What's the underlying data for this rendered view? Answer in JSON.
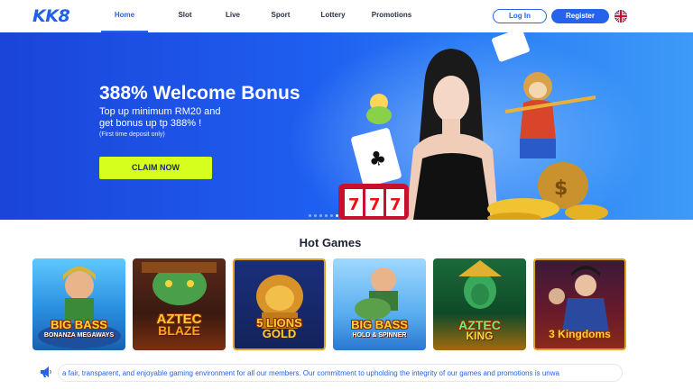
{
  "header": {
    "logo": "KK8",
    "nav": [
      {
        "label": "Home",
        "active": true
      },
      {
        "label": "Slot",
        "active": false
      },
      {
        "label": "Live",
        "active": false
      },
      {
        "label": "Sport",
        "active": false
      },
      {
        "label": "Lottery",
        "active": false
      },
      {
        "label": "Promotions",
        "active": false
      }
    ],
    "login_label": "Log In",
    "register_label": "Register",
    "language_icon": "uk-flag-icon"
  },
  "banner": {
    "title": "388% Welcome Bonus",
    "subtitle_line1": "Top up minimum RM20 and",
    "subtitle_line2": "get bonus up tp 388% !",
    "note": "(First time deposit only)",
    "cta_label": "CLAIM NOW",
    "slide_count": 6,
    "active_slide": 6
  },
  "hot_games": {
    "title": "Hot Games",
    "games": [
      {
        "name": "Big Bass Bonanza Megaways",
        "line1": "BIG BASS",
        "line2": "BONANZA MEGAWAYS"
      },
      {
        "name": "Aztec Blaze",
        "line1": "AZTEC",
        "line2": "BLAZE"
      },
      {
        "name": "5 Lions Gold",
        "line1": "5 LIONS",
        "line2": "GOLD"
      },
      {
        "name": "Big Bass Hold & Spinner",
        "line1": "BIG BASS",
        "line2": "HOLD & SPINNER"
      },
      {
        "name": "Aztec King",
        "line1": "AZTEC",
        "line2": "KING"
      },
      {
        "name": "3 Kingdoms",
        "line1": "3 Kingdoms",
        "line2": ""
      }
    ]
  },
  "announcement": {
    "icon": "megaphone-icon",
    "text": "a fair, transparent, and enjoyable gaming environment for all our members. Our commitment to upholding the integrity of our games and promotions is unwa"
  },
  "colors": {
    "brand": "#2563eb",
    "cta": "#d7ff1e",
    "banner_start": "#1b44d9",
    "banner_end": "#3d9af7"
  }
}
